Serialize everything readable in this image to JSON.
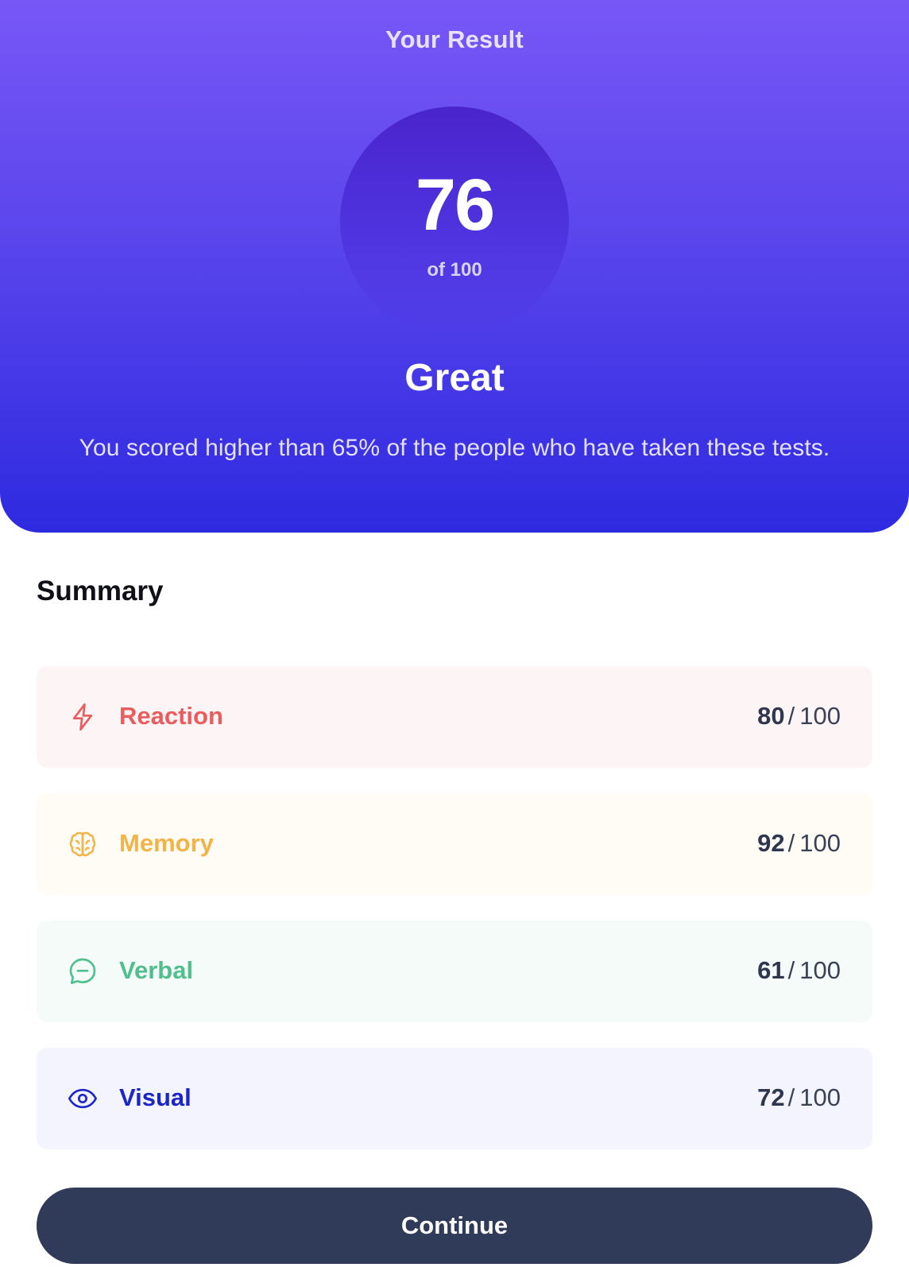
{
  "result": {
    "heading": "Your Result",
    "score": "76",
    "score_total": "of 100",
    "rating": "Great",
    "description": "You scored higher than 65% of the people who have taken these tests."
  },
  "summary": {
    "title": "Summary",
    "items": [
      {
        "icon": "lightning-icon",
        "label": "Reaction",
        "score": "80",
        "separator": "/",
        "max": "100",
        "color": "#ea5d5f",
        "bg": "#fdf5f5"
      },
      {
        "icon": "brain-icon",
        "label": "Memory",
        "score": "92",
        "separator": "/",
        "max": "100",
        "color": "#f2b349",
        "bg": "#fffbf5"
      },
      {
        "icon": "chat-bubble-icon",
        "label": "Verbal",
        "score": "61",
        "separator": "/",
        "max": "100",
        "color": "#4fbf8d",
        "bg": "#f4fbf8"
      },
      {
        "icon": "eye-icon",
        "label": "Visual",
        "score": "72",
        "separator": "/",
        "max": "100",
        "color": "#1c25c8",
        "bg": "#f3f4fd"
      }
    ]
  },
  "actions": {
    "continue_label": "Continue"
  },
  "colors": {
    "button_bg": "#303b5a",
    "gradient_top": "#7857f7",
    "gradient_bottom": "#2e2ae0"
  }
}
